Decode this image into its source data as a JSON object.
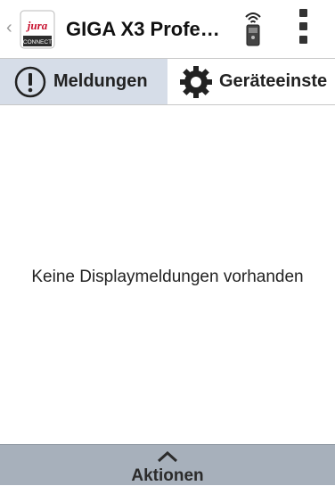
{
  "header": {
    "title": "GIGA X3 Profe…",
    "back_icon": "chevron-left-icon",
    "logo_text": "jura",
    "logo_subtext": "CONNECT",
    "remote_icon": "wireless-remote-icon",
    "menu_icon": "more-vertical-icon"
  },
  "tabs": [
    {
      "label": "Meldungen",
      "icon": "exclamation-circle-icon",
      "selected": true
    },
    {
      "label": "Geräteeinste",
      "icon": "gear-icon",
      "selected": false
    }
  ],
  "main": {
    "empty_message": "Keine Displaymeldungen vorhanden"
  },
  "footer": {
    "label": "Aktionen",
    "icon": "chevron-up-icon"
  },
  "colors": {
    "tab_selected_bg": "#d6dde8",
    "footer_bg": "#a7b0bb",
    "brand_red": "#c8102e"
  }
}
